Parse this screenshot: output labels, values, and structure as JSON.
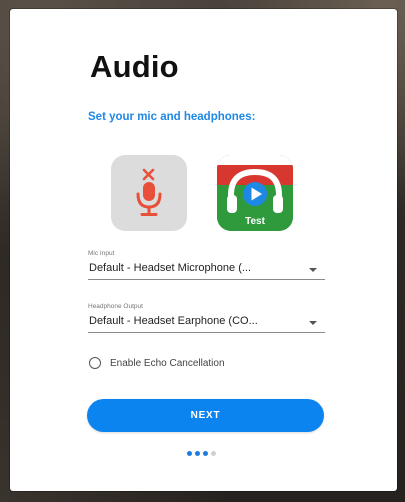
{
  "page": {
    "title": "Audio",
    "subtitle": "Set your mic and headphones:"
  },
  "tiles": {
    "mic": {
      "icon": "microphone-muted-icon",
      "state": "muted"
    },
    "test": {
      "icon": "headphones-play-icon",
      "label": "Test"
    }
  },
  "mic_input": {
    "label": "Mic Input",
    "value": "Default - Headset Microphone (..."
  },
  "headphone_output": {
    "label": "Headphone Output",
    "value": "Default - Headset Earphone (CO..."
  },
  "echo": {
    "label": "Enable Echo Cancellation",
    "checked": false
  },
  "next_button": {
    "label": "NEXT"
  },
  "pagination": {
    "total": 4,
    "active": [
      1,
      2,
      3
    ]
  },
  "colors": {
    "accent": "#0b84f0",
    "subtitle": "#1e88e5",
    "mic_red": "#e8503a",
    "test_green": "#2f9a3c",
    "test_red": "#d8372f"
  }
}
